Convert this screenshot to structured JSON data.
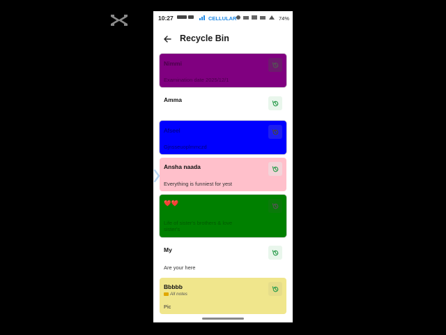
{
  "status_bar": {
    "time": "10:27",
    "carrier": "CELLULAR",
    "battery": "74%"
  },
  "header": {
    "title": "Recycle Bin"
  },
  "notes": [
    {
      "title": "Nimmi",
      "body": "Examination date 2025/12/1",
      "bg": "#800080",
      "title_color": "#4a004a",
      "body_color": "#4a004a",
      "restore_color": "#555555",
      "restore_bg": "#6d1a6d"
    },
    {
      "title": "Amma",
      "body": "",
      "bg": "#ffffff",
      "title_color": "#111111",
      "body_color": "#333333",
      "restore_color": "#2e9e4f",
      "restore_bg": "#e9f6ec"
    },
    {
      "title": "Afseel",
      "body": "Gjnsseuoplmmczd",
      "bg": "#0000ff",
      "title_color": "#00007a",
      "body_color": "#00007a",
      "restore_color": "#444444",
      "restore_bg": "#1d1df0"
    },
    {
      "title": "Ansha naada",
      "body": "Everything is funniest for yest",
      "bg": "#ffc0cb",
      "title_color": "#111111",
      "body_color": "#333333",
      "restore_color": "#2e9e4f",
      "restore_bg": "#f3d4d9"
    },
    {
      "title": "❤️❤️",
      "body": "Life of sister's brothers & love sister's",
      "bg": "#008000",
      "title_color": "#c0392b",
      "body_color": "#005a00",
      "restore_color": "#555555",
      "restore_bg": "#0a7a0a"
    },
    {
      "title": "My",
      "body": "Are your here",
      "bg": "#ffffff",
      "title_color": "#111111",
      "body_color": "#333333",
      "restore_color": "#2e9e4f",
      "restore_bg": "#e9f6ec"
    },
    {
      "title": "Bbbbb",
      "folder": "All notes",
      "body": "Pic",
      "bg": "#f0e68c",
      "title_color": "#111111",
      "body_color": "#333333",
      "restore_color": "#2e9e4f",
      "restore_bg": "#e6dd8a"
    }
  ],
  "icons": {
    "back": "arrow-left-icon",
    "restore": "restore-history-icon",
    "folder": "folder-icon",
    "logo": "capcut-logo-icon"
  }
}
